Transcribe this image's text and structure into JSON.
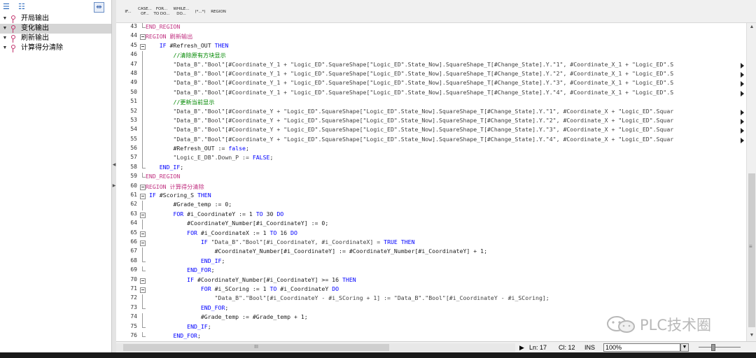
{
  "tree": {
    "toolbar_icons": [
      "expand-all-icon",
      "collapse-all-icon",
      "hide-navigation-icon"
    ],
    "items": [
      {
        "label": "开局输出",
        "selected": false
      },
      {
        "label": "变化输出",
        "selected": true
      },
      {
        "label": "刷新输出",
        "selected": false
      },
      {
        "label": "计算得分清除",
        "selected": false
      }
    ]
  },
  "instructions": [
    {
      "label": "IF..."
    },
    {
      "label": "CASE... OF..."
    },
    {
      "label": "FOR... TO DO..."
    },
    {
      "label": "WHILE... DO..."
    },
    {
      "label": "(*...*)"
    },
    {
      "label": "REGION"
    }
  ],
  "code": {
    "lines": [
      {
        "n": "43",
        "g": "end",
        "t": [
          [
            "reg",
            "END_REGION"
          ]
        ]
      },
      {
        "n": "44",
        "g": "box",
        "t": [
          [
            "reg",
            "REGION 刷新输出"
          ]
        ]
      },
      {
        "n": "45",
        "g": "box",
        "t": [
          [
            "txt",
            "    "
          ],
          [
            "kw",
            "IF"
          ],
          [
            "var",
            " #Refresh_OUT "
          ],
          [
            "kw",
            "THEN"
          ]
        ]
      },
      {
        "n": "46",
        "g": "line",
        "t": [
          [
            "txt",
            "        "
          ],
          [
            "cm",
            "//清除原有方块显示"
          ]
        ]
      },
      {
        "n": "47",
        "g": "line",
        "t": [
          [
            "txt",
            "        "
          ],
          [
            "str",
            "\"Data_B\".\"Bool\"[#Coordinate_Y_1 + \"Logic_ED\".SquareShape[\"Logic_ED\".State_Now].SquareShape_T[#Change_State].Y.\"1\", #Coordinate_X_1 + \"Logic_ED\".S"
          ]
        ],
        "more": true
      },
      {
        "n": "48",
        "g": "line",
        "t": [
          [
            "txt",
            "        "
          ],
          [
            "str",
            "\"Data_B\".\"Bool\"[#Coordinate_Y_1 + \"Logic_ED\".SquareShape[\"Logic_ED\".State_Now].SquareShape_T[#Change_State].Y.\"2\", #Coordinate_X_1 + \"Logic_ED\".S"
          ]
        ],
        "more": true
      },
      {
        "n": "49",
        "g": "line",
        "t": [
          [
            "txt",
            "        "
          ],
          [
            "str",
            "\"Data_B\".\"Bool\"[#Coordinate_Y_1 + \"Logic_ED\".SquareShape[\"Logic_ED\".State_Now].SquareShape_T[#Change_State].Y.\"3\", #Coordinate_X_1 + \"Logic_ED\".S"
          ]
        ],
        "more": true
      },
      {
        "n": "50",
        "g": "line",
        "t": [
          [
            "txt",
            "        "
          ],
          [
            "str",
            "\"Data_B\".\"Bool\"[#Coordinate_Y_1 + \"Logic_ED\".SquareShape[\"Logic_ED\".State_Now].SquareShape_T[#Change_State].Y.\"4\", #Coordinate_X_1 + \"Logic_ED\".S"
          ]
        ],
        "more": true
      },
      {
        "n": "51",
        "g": "line",
        "t": [
          [
            "txt",
            "        "
          ],
          [
            "cm",
            "//更新当前显示"
          ]
        ]
      },
      {
        "n": "52",
        "g": "line",
        "t": [
          [
            "txt",
            "        "
          ],
          [
            "str",
            "\"Data_B\".\"Bool\"[#Coordinate_Y + \"Logic_ED\".SquareShape[\"Logic_ED\".State_Now].SquareShape_T[#Change_State].Y.\"1\", #Coordinate_X + \"Logic_ED\".Squar"
          ]
        ],
        "more": true
      },
      {
        "n": "53",
        "g": "line",
        "t": [
          [
            "txt",
            "        "
          ],
          [
            "str",
            "\"Data_B\".\"Bool\"[#Coordinate_Y + \"Logic_ED\".SquareShape[\"Logic_ED\".State_Now].SquareShape_T[#Change_State].Y.\"2\", #Coordinate_X + \"Logic_ED\".Squar"
          ]
        ],
        "more": true
      },
      {
        "n": "54",
        "g": "line",
        "t": [
          [
            "txt",
            "        "
          ],
          [
            "str",
            "\"Data_B\".\"Bool\"[#Coordinate_Y + \"Logic_ED\".SquareShape[\"Logic_ED\".State_Now].SquareShape_T[#Change_State].Y.\"3\", #Coordinate_X + \"Logic_ED\".Squar"
          ]
        ],
        "more": true
      },
      {
        "n": "55",
        "g": "line",
        "t": [
          [
            "txt",
            "        "
          ],
          [
            "str",
            "\"Data_B\".\"Bool\"[#Coordinate_Y + \"Logic_ED\".SquareShape[\"Logic_ED\".State_Now].SquareShape_T[#Change_State].Y.\"4\", #Coordinate_X + \"Logic_ED\".Squar"
          ]
        ],
        "more": true
      },
      {
        "n": "56",
        "g": "line",
        "t": [
          [
            "txt",
            "        "
          ],
          [
            "var",
            "#Refresh_OUT := "
          ],
          [
            "kw",
            "false"
          ],
          [
            "var",
            ";"
          ]
        ]
      },
      {
        "n": "57",
        "g": "line",
        "t": [
          [
            "txt",
            "        "
          ],
          [
            "str",
            "\"Logic_E_DB\".Down_P := "
          ],
          [
            "kw",
            "FALSE"
          ],
          [
            "var",
            ";"
          ]
        ]
      },
      {
        "n": "58",
        "g": "end",
        "t": [
          [
            "txt",
            "    "
          ],
          [
            "kw",
            "END_IF"
          ],
          [
            "var",
            ";"
          ]
        ]
      },
      {
        "n": "59",
        "g": "end",
        "t": [
          [
            "reg",
            "END_REGION"
          ]
        ]
      },
      {
        "n": "60",
        "g": "box",
        "t": [
          [
            "reg",
            "REGION 计算得分清除"
          ]
        ]
      },
      {
        "n": "61",
        "g": "box",
        "t": [
          [
            "txt",
            " "
          ],
          [
            "kw",
            "IF"
          ],
          [
            "var",
            " #Scoring_S "
          ],
          [
            "kw",
            "THEN"
          ]
        ]
      },
      {
        "n": "62",
        "g": "line",
        "t": [
          [
            "txt",
            "        "
          ],
          [
            "var",
            "#Grade_temp := 0;"
          ]
        ]
      },
      {
        "n": "63",
        "g": "box",
        "t": [
          [
            "txt",
            "        "
          ],
          [
            "kw",
            "FOR"
          ],
          [
            "var",
            " #i_CoordinateY := 1 "
          ],
          [
            "kw",
            "TO"
          ],
          [
            "var",
            " 30 "
          ],
          [
            "kw",
            "DO"
          ]
        ]
      },
      {
        "n": "64",
        "g": "line",
        "t": [
          [
            "txt",
            "            "
          ],
          [
            "var",
            "#CoordinateY_Number[#i_CoordinateY] := 0;"
          ]
        ]
      },
      {
        "n": "65",
        "g": "box",
        "t": [
          [
            "txt",
            "            "
          ],
          [
            "kw",
            "FOR"
          ],
          [
            "var",
            " #i_CoordinateX := 1 "
          ],
          [
            "kw",
            "TO"
          ],
          [
            "var",
            " 16 "
          ],
          [
            "kw",
            "DO"
          ]
        ]
      },
      {
        "n": "66",
        "g": "box",
        "t": [
          [
            "txt",
            "                "
          ],
          [
            "kw",
            "IF"
          ],
          [
            "str",
            " \"Data_B\".\"Bool\"[#i_CoordinateY, #i_CoordinateX] = "
          ],
          [
            "kw",
            "TRUE THEN"
          ]
        ]
      },
      {
        "n": "67",
        "g": "line",
        "t": [
          [
            "txt",
            "                    "
          ],
          [
            "var",
            "#CoordinateY_Number[#i_CoordinateY] := #CoordinateY_Number[#i_CoordinateY] + 1;"
          ]
        ]
      },
      {
        "n": "68",
        "g": "end",
        "t": [
          [
            "txt",
            "                "
          ],
          [
            "kw",
            "END_IF"
          ],
          [
            "var",
            ";"
          ]
        ]
      },
      {
        "n": "69",
        "g": "end",
        "t": [
          [
            "txt",
            "            "
          ],
          [
            "kw",
            "END_FOR"
          ],
          [
            "var",
            ";"
          ]
        ]
      },
      {
        "n": "70",
        "g": "box",
        "t": [
          [
            "txt",
            "            "
          ],
          [
            "kw",
            "IF"
          ],
          [
            "var",
            " #CoordinateY_Number[#i_CoordinateY] >= 16 "
          ],
          [
            "kw",
            "THEN"
          ]
        ]
      },
      {
        "n": "71",
        "g": "box",
        "t": [
          [
            "txt",
            "                "
          ],
          [
            "kw",
            "FOR"
          ],
          [
            "var",
            " #i_SCoring := 1 "
          ],
          [
            "kw",
            "TO"
          ],
          [
            "var",
            " #i_CoordinateY "
          ],
          [
            "kw",
            "DO"
          ]
        ]
      },
      {
        "n": "72",
        "g": "line",
        "t": [
          [
            "txt",
            "                    "
          ],
          [
            "str",
            "\"Data_B\".\"Bool\"[#i_CoordinateY - #i_SCoring + 1] := \"Data_B\".\"Bool\"[#i_CoordinateY - #i_SCoring];"
          ]
        ]
      },
      {
        "n": "73",
        "g": "end",
        "t": [
          [
            "txt",
            "                "
          ],
          [
            "kw",
            "END_FOR"
          ],
          [
            "var",
            ";"
          ]
        ]
      },
      {
        "n": "74",
        "g": "line",
        "t": [
          [
            "txt",
            "                "
          ],
          [
            "var",
            "#Grade_temp := #Grade_temp + 1;"
          ]
        ]
      },
      {
        "n": "75",
        "g": "end",
        "t": [
          [
            "txt",
            "            "
          ],
          [
            "kw",
            "END_IF"
          ],
          [
            "var",
            ";"
          ]
        ]
      },
      {
        "n": "76",
        "g": "end",
        "t": [
          [
            "txt",
            "        "
          ],
          [
            "kw",
            "END_FOR"
          ],
          [
            "var",
            ";"
          ]
        ]
      }
    ]
  },
  "status": {
    "ln": "Ln: 17",
    "col": "Cl: 12",
    "mode": "INS",
    "zoom": "100%"
  },
  "watermark": {
    "text": "PLC技术圈"
  },
  "colors": {
    "keyword": "#0000ff",
    "region": "#c03080",
    "comment": "#008800"
  }
}
